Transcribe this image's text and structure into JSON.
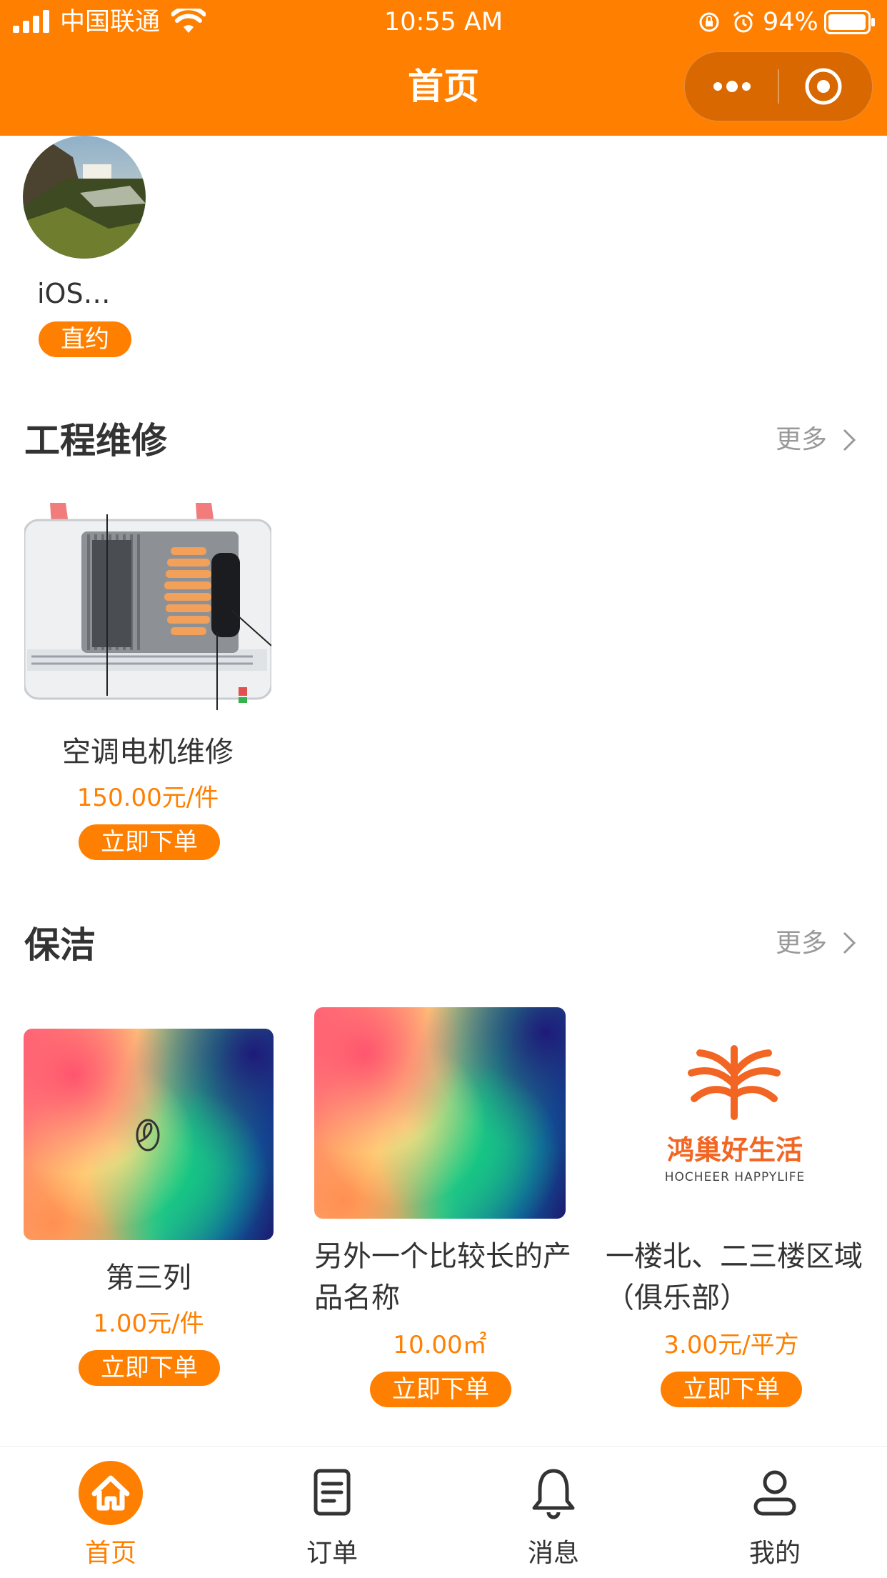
{
  "status_bar": {
    "carrier": "中国联通",
    "time": "10:55 AM",
    "battery": "94%"
  },
  "nav": {
    "title": "首页",
    "menu_icon": "more-dots-icon",
    "close_icon": "target-circle-icon"
  },
  "profile": {
    "name": "iOS…",
    "badge": "直约"
  },
  "sections": [
    {
      "title": "工程维修",
      "more_label": "更多",
      "items": [
        {
          "name": "空调电机维修",
          "price": "150.00元/件",
          "button": "立即下单"
        }
      ]
    },
    {
      "title": "保洁",
      "more_label": "更多",
      "items": [
        {
          "name": "第三列",
          "price": "1.00元/件",
          "button": "立即下单"
        },
        {
          "name": "另外一个比较长的产品名称",
          "price": "10.00㎡",
          "button": "立即下单"
        },
        {
          "name": "一楼北、二三楼区域（俱乐部）",
          "price": "3.00元/平方",
          "button": "立即下单",
          "logo_cn": "鸿巢好生活",
          "logo_en": "HOCHEER HAPPYLIFE"
        }
      ]
    }
  ],
  "tabbar": [
    {
      "label": "首页",
      "icon": "home-icon",
      "active": true
    },
    {
      "label": "订单",
      "icon": "document-icon",
      "active": false
    },
    {
      "label": "消息",
      "icon": "bell-icon",
      "active": false
    },
    {
      "label": "我的",
      "icon": "user-icon",
      "active": false
    }
  ],
  "colors": {
    "accent": "#ff7f00",
    "accent_dark": "#d96800",
    "text": "#333333",
    "muted": "#999999"
  }
}
